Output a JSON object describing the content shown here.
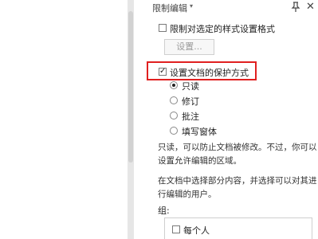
{
  "panel": {
    "title": "限制编辑",
    "title_dropdown_glyph": "▾",
    "close_glyph": "✕",
    "format_restriction": {
      "label": "限制对选定的样式设置格式",
      "checked": false
    },
    "settings_button": "设置...",
    "protection": {
      "label": "设置文档的保护方式",
      "checked": true,
      "check_glyph": "✓"
    },
    "modes": [
      {
        "label": "只读",
        "selected": true
      },
      {
        "label": "修订",
        "selected": false
      },
      {
        "label": "批注",
        "selected": false
      },
      {
        "label": "填写窗体",
        "selected": false
      }
    ],
    "description_1": "只读，可以防止文档被修改。不过，你可以设置允许编辑的区域。",
    "description_2": "在文档中选择部分内容，并选择可以对其进行编辑的用户。",
    "group_label": "组:",
    "group_everyone": {
      "label": "每个人",
      "checked": false
    }
  },
  "colors": {
    "highlight": "#e02020"
  }
}
